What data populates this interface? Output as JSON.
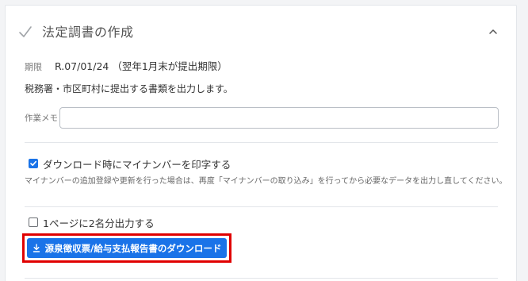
{
  "section": {
    "title": "法定調書の作成",
    "icons": {
      "status": "check-icon",
      "toggle": "chevron-up-icon"
    }
  },
  "deadline": {
    "label": "期限",
    "value": "R.07/01/24 （翌年1月末が提出期限）"
  },
  "description": "税務署・市区町村に提出する書類を出力します。",
  "memo": {
    "label": "作業メモ",
    "value": "",
    "placeholder": ""
  },
  "options": {
    "print_my_number": {
      "label": "ダウンロード時にマイナンバーを印字する",
      "checked": true
    },
    "note": "マイナンバーの追加登録や更新を行った場合は、再度「マイナンバーの取り込み」を行ってから必要なデータを出力し直してください。",
    "two_per_page": {
      "label": "1ページに2名分出力する",
      "checked": false
    }
  },
  "download_button": {
    "label": "源泉徴収票/給与支払報告書のダウンロード",
    "icon": "download-icon"
  },
  "colors": {
    "accent": "#1a73e8",
    "highlight": "#e00000",
    "check": "#a0a4a8"
  }
}
